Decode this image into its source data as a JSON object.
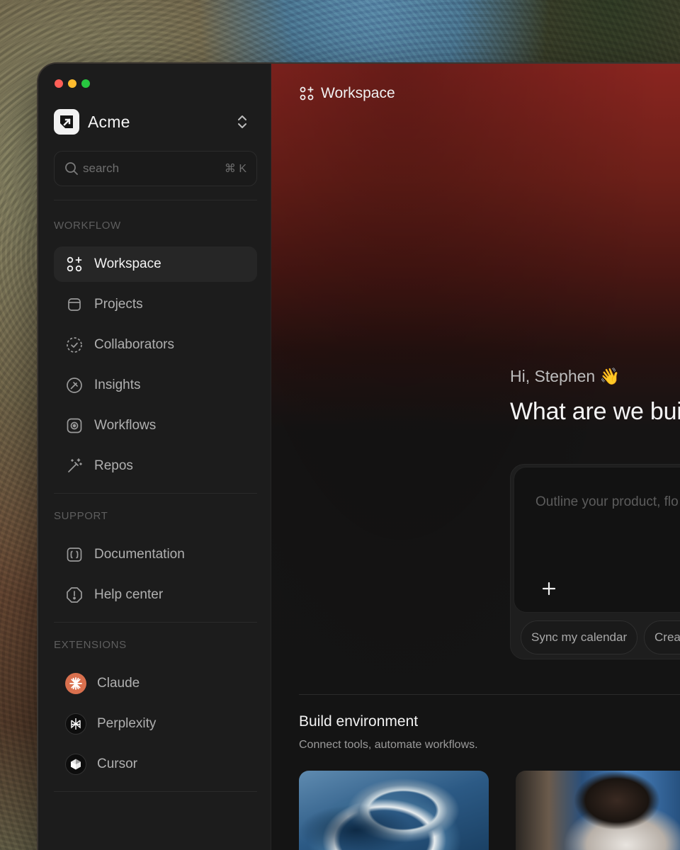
{
  "app": {
    "brand_name": "Acme",
    "accent_color": "#f2f2f2"
  },
  "search": {
    "placeholder": "search",
    "shortcut": "⌘ K"
  },
  "sidebar": {
    "workflow_label": "WORKFLOW",
    "workflow_items": [
      {
        "label": "Workspace",
        "icon": "workspace-icon",
        "active": true
      },
      {
        "label": "Projects",
        "icon": "projects-icon"
      },
      {
        "label": "Collaborators",
        "icon": "collaborators-icon"
      },
      {
        "label": "Insights",
        "icon": "insights-icon"
      },
      {
        "label": "Workflows",
        "icon": "workflows-icon"
      },
      {
        "label": "Repos",
        "icon": "magic-wand-icon"
      }
    ],
    "support_label": "SUPPORT",
    "support_items": [
      {
        "label": "Documentation",
        "icon": "braces-icon"
      },
      {
        "label": "Help center",
        "icon": "alert-octagon-icon"
      }
    ],
    "extensions_label": "EXTENSIONS",
    "extension_items": [
      {
        "label": "Claude",
        "icon": "claude-icon",
        "color": "#d9704e"
      },
      {
        "label": "Perplexity",
        "icon": "perplexity-icon",
        "color": "#0d0d0d"
      },
      {
        "label": "Cursor",
        "icon": "cursor-icon",
        "color": "#0d0d0d"
      }
    ]
  },
  "main": {
    "header_title": "Workspace",
    "greeting": "Hi, Stephen 👋",
    "headline": "What are we bui",
    "composer_placeholder": "Outline your product, flo",
    "chips": [
      "Sync my calendar",
      "Crea"
    ],
    "build_title": "Build environment",
    "build_subtitle": "Connect tools, automate workflows."
  }
}
